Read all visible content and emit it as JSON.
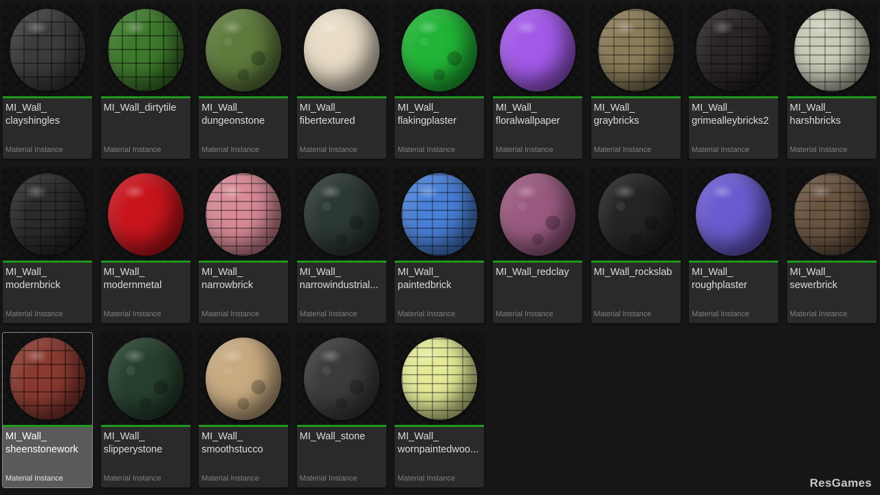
{
  "assets": [
    {
      "name": "MI_Wall_\nclayshingles",
      "type": "Material Instance",
      "color": "#3a3d3c",
      "pattern": "tiles",
      "selected": false
    },
    {
      "name": "MI_Wall_dirtytile",
      "type": "Material Instance",
      "color": "#3e7a2c",
      "pattern": "tiles",
      "selected": false
    },
    {
      "name": "MI_Wall_\ndungeonstone",
      "type": "Material Instance",
      "color": "#5e7a3c",
      "pattern": "noise",
      "selected": false
    },
    {
      "name": "MI_Wall_\nfibertextured",
      "type": "Material Instance",
      "color": "#e8dcc6",
      "pattern": "none",
      "selected": false
    },
    {
      "name": "MI_Wall_\nflakingplaster",
      "type": "Material Instance",
      "color": "#21b436",
      "pattern": "noise",
      "selected": false
    },
    {
      "name": "MI_Wall_\nfloralwallpaper",
      "type": "Material Instance",
      "color": "#a25ae8",
      "pattern": "none",
      "selected": false
    },
    {
      "name": "MI_Wall_\ngraybricks",
      "type": "Material Instance",
      "color": "#8a7c58",
      "pattern": "bricks",
      "selected": false
    },
    {
      "name": "MI_Wall_\ngrimealleybricks2",
      "type": "Material Instance",
      "color": "#2a2526",
      "pattern": "bricks",
      "selected": false
    },
    {
      "name": "MI_Wall_\nharshbricks",
      "type": "Material Instance",
      "color": "#c8cdb8",
      "pattern": "bricks",
      "selected": false
    },
    {
      "name": "MI_Wall_\nmodernbrick",
      "type": "Material Instance",
      "color": "#2a2b2c",
      "pattern": "bricks",
      "selected": false
    },
    {
      "name": "MI_Wall_\nmodernmetal",
      "type": "Material Instance",
      "color": "#c8141c",
      "pattern": "none",
      "selected": false
    },
    {
      "name": "MI_Wall_\nnarrowbrick",
      "type": "Material Instance",
      "color": "#d88a96",
      "pattern": "bricks",
      "selected": false
    },
    {
      "name": "MI_Wall_\nnarrowindustrial...",
      "type": "Material Instance",
      "color": "#2c3834",
      "pattern": "noise",
      "selected": false
    },
    {
      "name": "MI_Wall_\npaintedbrick",
      "type": "Material Instance",
      "color": "#4a80d8",
      "pattern": "bricks",
      "selected": false
    },
    {
      "name": "MI_Wall_redclay",
      "type": "Material Instance",
      "color": "#9a5a80",
      "pattern": "noise",
      "selected": false
    },
    {
      "name": "MI_Wall_rockslab",
      "type": "Material Instance",
      "color": "#222426",
      "pattern": "noise",
      "selected": false
    },
    {
      "name": "MI_Wall_\nroughplaster",
      "type": "Material Instance",
      "color": "#6a5cd0",
      "pattern": "none",
      "selected": false
    },
    {
      "name": "MI_Wall_\nsewerbrick",
      "type": "Material Instance",
      "color": "#6a5440",
      "pattern": "bricks",
      "selected": false
    },
    {
      "name": "MI_Wall_\nsheenstonework",
      "type": "Material Instance",
      "color": "#8a3a30",
      "pattern": "tiles",
      "selected": true
    },
    {
      "name": "MI_Wall_\nslipperystone",
      "type": "Material Instance",
      "color": "#27402e",
      "pattern": "noise",
      "selected": false
    },
    {
      "name": "MI_Wall_\nsmoothstucco",
      "type": "Material Instance",
      "color": "#c8aa80",
      "pattern": "noise",
      "selected": false
    },
    {
      "name": "MI_Wall_stone",
      "type": "Material Instance",
      "color": "#3a3c3a",
      "pattern": "noise",
      "selected": false
    },
    {
      "name": "MI_Wall_\nwornpaintedwoo...",
      "type": "Material Instance",
      "color": "#e4ea98",
      "pattern": "bricks",
      "selected": false
    }
  ],
  "watermark": "ResGames"
}
